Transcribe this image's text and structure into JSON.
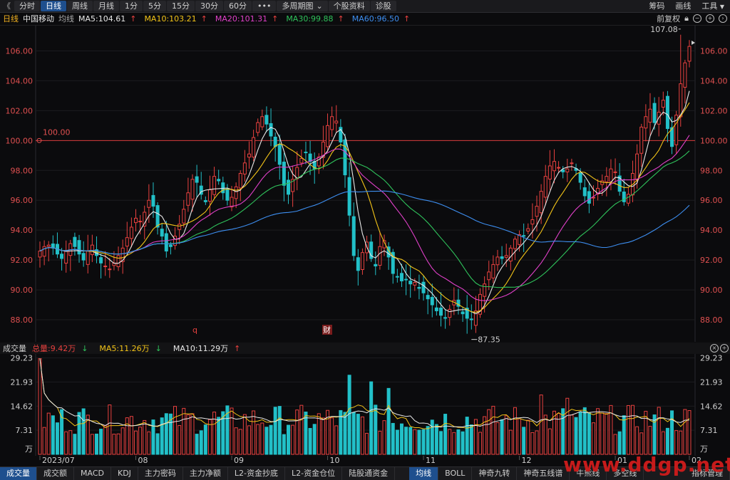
{
  "toolbar": {
    "back": "《",
    "items": [
      "分时",
      "日线",
      "周线",
      "月线",
      "1分",
      "5分",
      "15分",
      "30分",
      "60分",
      "•••",
      "多周期图",
      "个股资料",
      "诊股"
    ],
    "active": "日线",
    "dropdown_mark": "⌄",
    "right": [
      "筹码",
      "画线",
      "工具"
    ]
  },
  "info": {
    "period": "日线",
    "stock": "中国移动",
    "ma_label": "均线",
    "ma": [
      {
        "text": "MA5:104.61",
        "color": "#e8e8e8"
      },
      {
        "text": "MA10:103.21",
        "color": "#f2c318"
      },
      {
        "text": "MA20:101.31",
        "color": "#e040c8"
      },
      {
        "text": "MA30:99.88",
        "color": "#2fc25b"
      },
      {
        "text": "MA60:96.50",
        "color": "#3d8ef0"
      }
    ],
    "up_arrow": "↑",
    "adjust": "前复权"
  },
  "price_axis": {
    "ticks": [
      "106.00",
      "104.00",
      "102.00",
      "100.00",
      "98.00",
      "96.00",
      "94.00",
      "92.00",
      "90.00",
      "88.00"
    ]
  },
  "annotations": {
    "hline_label": "100.00",
    "high": "107.08",
    "low": "87.35",
    "marker_q": "q",
    "marker_cai": "财"
  },
  "volume": {
    "title": "成交量",
    "total": "总量:9.42万",
    "ma5": "MA5:11.26万",
    "ma10": "MA10:11.29万",
    "down_arrow": "↓",
    "up_arrow": "↑",
    "ticks": [
      "29.23",
      "21.93",
      "14.62",
      "7.31"
    ],
    "unit": "万"
  },
  "dates": [
    "2023/07",
    "08",
    "09",
    "10",
    "11",
    "12",
    "01",
    "02"
  ],
  "bottom_tabs": [
    "成交量",
    "成交额",
    "MACD",
    "KDJ",
    "主力密码",
    "主力净额",
    "L2-资金抄底",
    "L2-资金仓位",
    "陆股通资金",
    "均线",
    "BOLL",
    "神奇九转",
    "神奇五线谱",
    "牛熊线",
    "多空线",
    "指标管理"
  ],
  "bottom_active": [
    "成交量",
    "均线"
  ],
  "watermark": "www.ddgp.net",
  "colors": {
    "up": "#e8413f",
    "down": "#22c0c8",
    "ma5": "#e8e8e8",
    "ma10": "#f2c318",
    "ma20": "#e040c8",
    "ma30": "#2fc25b",
    "ma60": "#3d8ef0"
  },
  "chart_data": {
    "type": "candlestick",
    "y_range": [
      87.0,
      107.5
    ],
    "hline": 100.0,
    "close_series": [
      92.6,
      92.9,
      93.0,
      92.8,
      92.4,
      92.1,
      92.6,
      93.1,
      92.9,
      92.4,
      92.0,
      92.6,
      93.0,
      92.3,
      91.8,
      91.6,
      91.4,
      91.8,
      92.3,
      92.8,
      93.5,
      94.2,
      94.8,
      94.6,
      95.2,
      96.0,
      95.6,
      94.2,
      93.6,
      92.6,
      92.9,
      93.6,
      94.4,
      95.4,
      96.5,
      97.4,
      97.2,
      96.4,
      95.9,
      96.7,
      97.6,
      97.3,
      96.5,
      96.0,
      96.2,
      96.9,
      97.8,
      98.5,
      99.1,
      100.2,
      101.2,
      101.6,
      101.1,
      100.3,
      99.6,
      98.4,
      97.0,
      96.4,
      97.4,
      98.2,
      98.8,
      99.2,
      98.6,
      98.1,
      98.9,
      99.9,
      101.0,
      101.6,
      101.3,
      99.9,
      97.7,
      95.0,
      92.3,
      91.3,
      92.5,
      93.2,
      92.1,
      91.6,
      92.9,
      93.3,
      92.2,
      91.1,
      90.9,
      90.6,
      90.7,
      90.4,
      90.5,
      90.1,
      89.8,
      89.4,
      89.0,
      88.6,
      88.3,
      88.1,
      88.7,
      89.3,
      88.9,
      88.4,
      88.1,
      88.0,
      88.6,
      89.7,
      90.4,
      91.2,
      91.7,
      92.2,
      92.1,
      92.3,
      92.8,
      93.4,
      93.7,
      93.6,
      94.1,
      94.7,
      95.6,
      96.6,
      97.6,
      98.3,
      98.6,
      98.2,
      97.9,
      98.1,
      98.5,
      98.0,
      97.2,
      96.3,
      95.8,
      96.2,
      96.8,
      97.3,
      97.6,
      98.1,
      97.9,
      96.6,
      95.9,
      96.4,
      97.8,
      99.1,
      100.9,
      101.6,
      102.1,
      101.2,
      101.9,
      102.7,
      100.8,
      99.6,
      101.7,
      103.8,
      105.2,
      106.3
    ]
  }
}
